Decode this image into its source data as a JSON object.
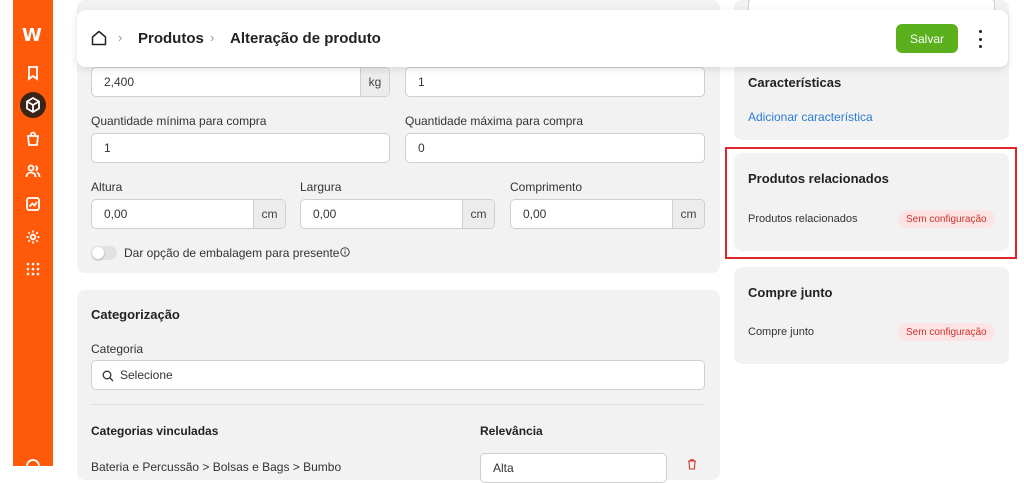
{
  "sidebar": {
    "logo": "W",
    "icons": [
      "bookmark-icon",
      "cube-icon",
      "bag-icon",
      "users-icon",
      "chart-icon",
      "gear-icon",
      "grid-icon"
    ]
  },
  "header": {
    "breadcrumb": [
      "Produtos",
      "Alteração de produto"
    ],
    "save_label": "Salvar"
  },
  "form": {
    "weight_value": "2,400",
    "weight_unit": "kg",
    "top_right_value": "1",
    "min_qty_label": "Quantidade mínima para compra",
    "min_qty_value": "1",
    "max_qty_label": "Quantidade máxima para compra",
    "max_qty_value": "0",
    "height_label": "Altura",
    "height_value": "0,00",
    "height_unit": "cm",
    "width_label": "Largura",
    "width_value": "0,00",
    "width_unit": "cm",
    "length_label": "Comprimento",
    "length_value": "0,00",
    "length_unit": "cm",
    "gift_toggle_label": "Dar opção de embalagem para presente"
  },
  "categorization": {
    "title": "Categorização",
    "category_label": "Categoria",
    "category_placeholder": "Selecione",
    "linked_label": "Categorias vinculadas",
    "relevance_label": "Relevância",
    "row_text": "Bateria e Percussão > Bolsas e Bags > Bumbo",
    "row_relevance": "Alta"
  },
  "right_panel": {
    "characteristics_title": "Características",
    "add_characteristic": "Adicionar característica",
    "related_title": "Produtos relacionados",
    "related_item": "Produtos relacionados",
    "related_status": "Sem configuração",
    "buy_together_title": "Compre junto",
    "buy_together_item": "Compre junto",
    "buy_together_status": "Sem configuração"
  },
  "colors": {
    "brand": "#ff5a0a",
    "save": "#5ab01d",
    "badge_text": "#d0312d",
    "badge_bg": "#fde4e4",
    "highlight": "#e0262a",
    "link": "#2b7bd6"
  }
}
